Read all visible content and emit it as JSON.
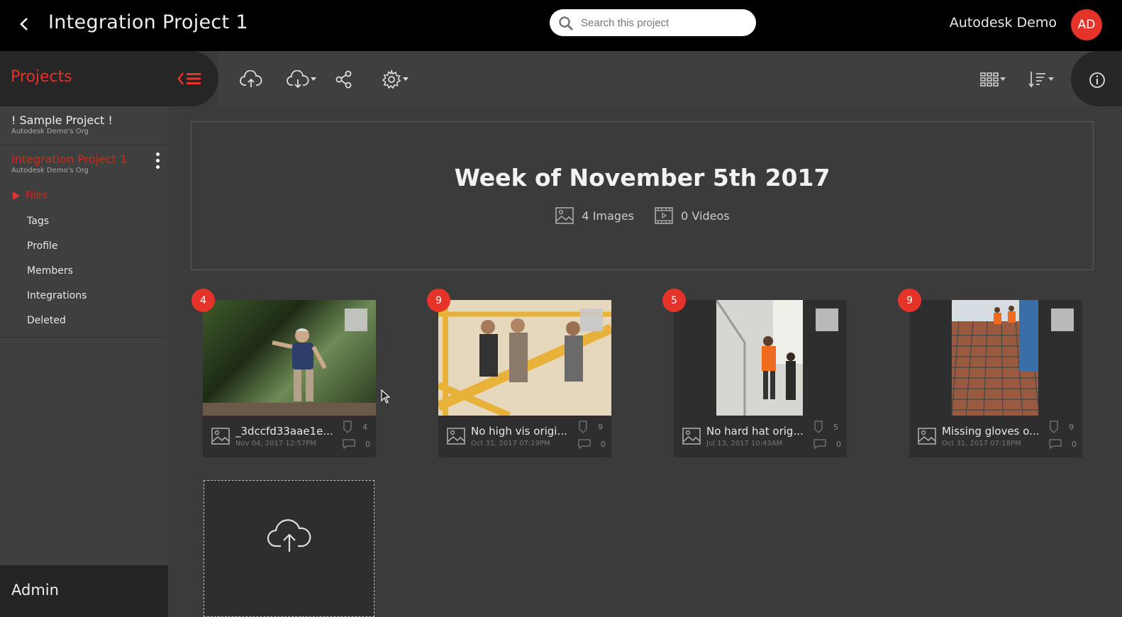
{
  "header": {
    "back_icon": "chevron-left-icon",
    "title": "Integration Project 1",
    "search_placeholder": "Search this project",
    "user_name": "Autodesk Demo",
    "avatar_initials": "AD",
    "accent_color": "#e5332a"
  },
  "sidebar": {
    "header_label": "Projects",
    "projects": [
      {
        "name": "! Sample Project !",
        "org": "Autodesk Demo's Org",
        "active": false
      },
      {
        "name": "Integration Project 1",
        "org": "Autodesk Demo's Org",
        "active": true
      }
    ],
    "files_label": "Files",
    "nav": [
      "Tags",
      "Profile",
      "Members",
      "Integrations",
      "Deleted"
    ],
    "admin_label": "Admin"
  },
  "toolbar": {
    "icons": [
      "upload-cloud-icon",
      "download-cloud-icon",
      "share-icon",
      "settings-icon",
      "grid-view-icon",
      "sort-icon",
      "info-icon"
    ]
  },
  "week": {
    "title": "Week of November 5th 2017",
    "images": "4 Images",
    "videos": "0 Videos"
  },
  "cards": [
    {
      "badge": "4",
      "name": "_3dccfd33aae1e...",
      "date": "Nov 04, 2017 12:57PM",
      "tags": "4",
      "comments": "0"
    },
    {
      "badge": "9",
      "name": "No high vis origi...",
      "date": "Oct 31, 2017 07:19PM",
      "tags": "9",
      "comments": "0"
    },
    {
      "badge": "5",
      "name": "No hard hat orig...",
      "date": "Jul 13, 2017 10:43AM",
      "tags": "5",
      "comments": "0"
    },
    {
      "badge": "9",
      "name": "Missing gloves o...",
      "date": "Oct 31, 2017 07:18PM",
      "tags": "9",
      "comments": "0"
    }
  ]
}
